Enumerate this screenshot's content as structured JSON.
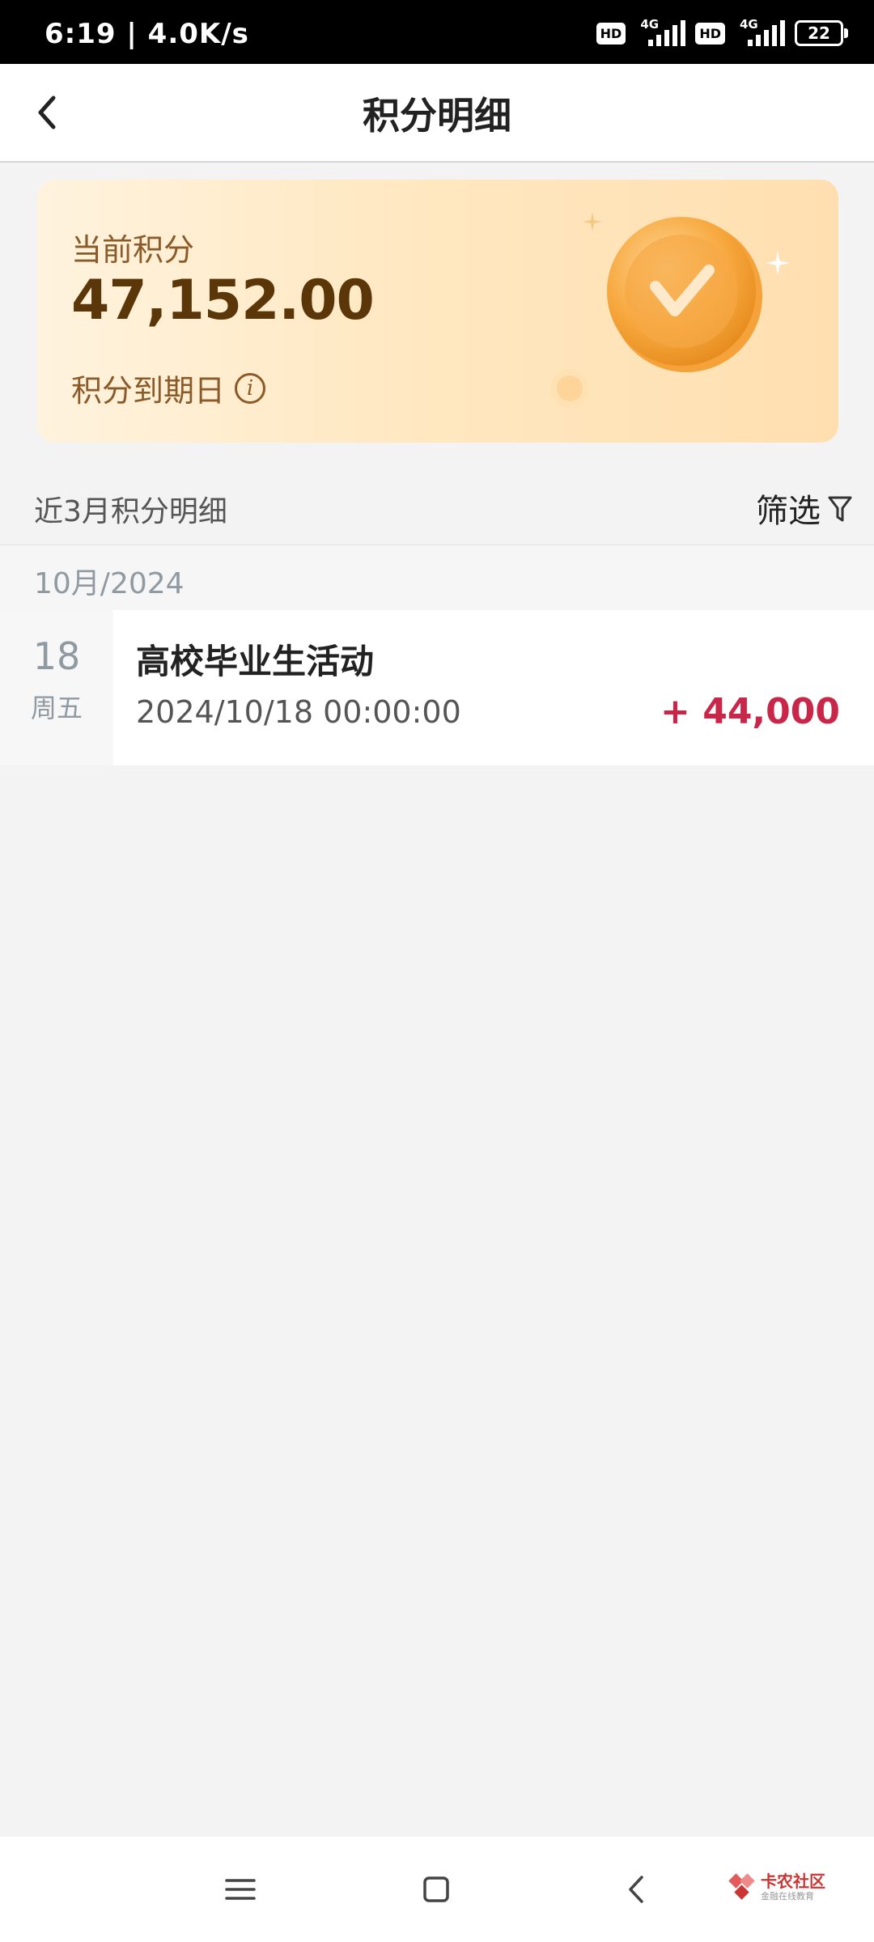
{
  "status_bar": {
    "time": "6:19 | 4.0K/s",
    "hd1": "HD",
    "net1": "4G",
    "hd2": "HD",
    "net2": "4G",
    "battery": "22"
  },
  "header": {
    "title": "积分明细"
  },
  "card": {
    "current_label": "当前积分",
    "points": "47,152.00",
    "expiry_label": "积分到期日",
    "info_glyph": "i"
  },
  "list": {
    "range_label": "近3月积分明细",
    "filter_label": "筛选",
    "month": "10月/2024",
    "records": [
      {
        "day": "18",
        "weekday": "周五",
        "name": "高校毕业生活动",
        "time": "2024/10/18 00:00:00",
        "amount": "+ 44,000"
      }
    ]
  },
  "watermark": {
    "title": "卡农社区",
    "subtitle": "金融在线教育"
  },
  "colors": {
    "accent_amount": "#c8274a",
    "card_text": "#5b3608",
    "card_bg": "#ffe8c2"
  }
}
